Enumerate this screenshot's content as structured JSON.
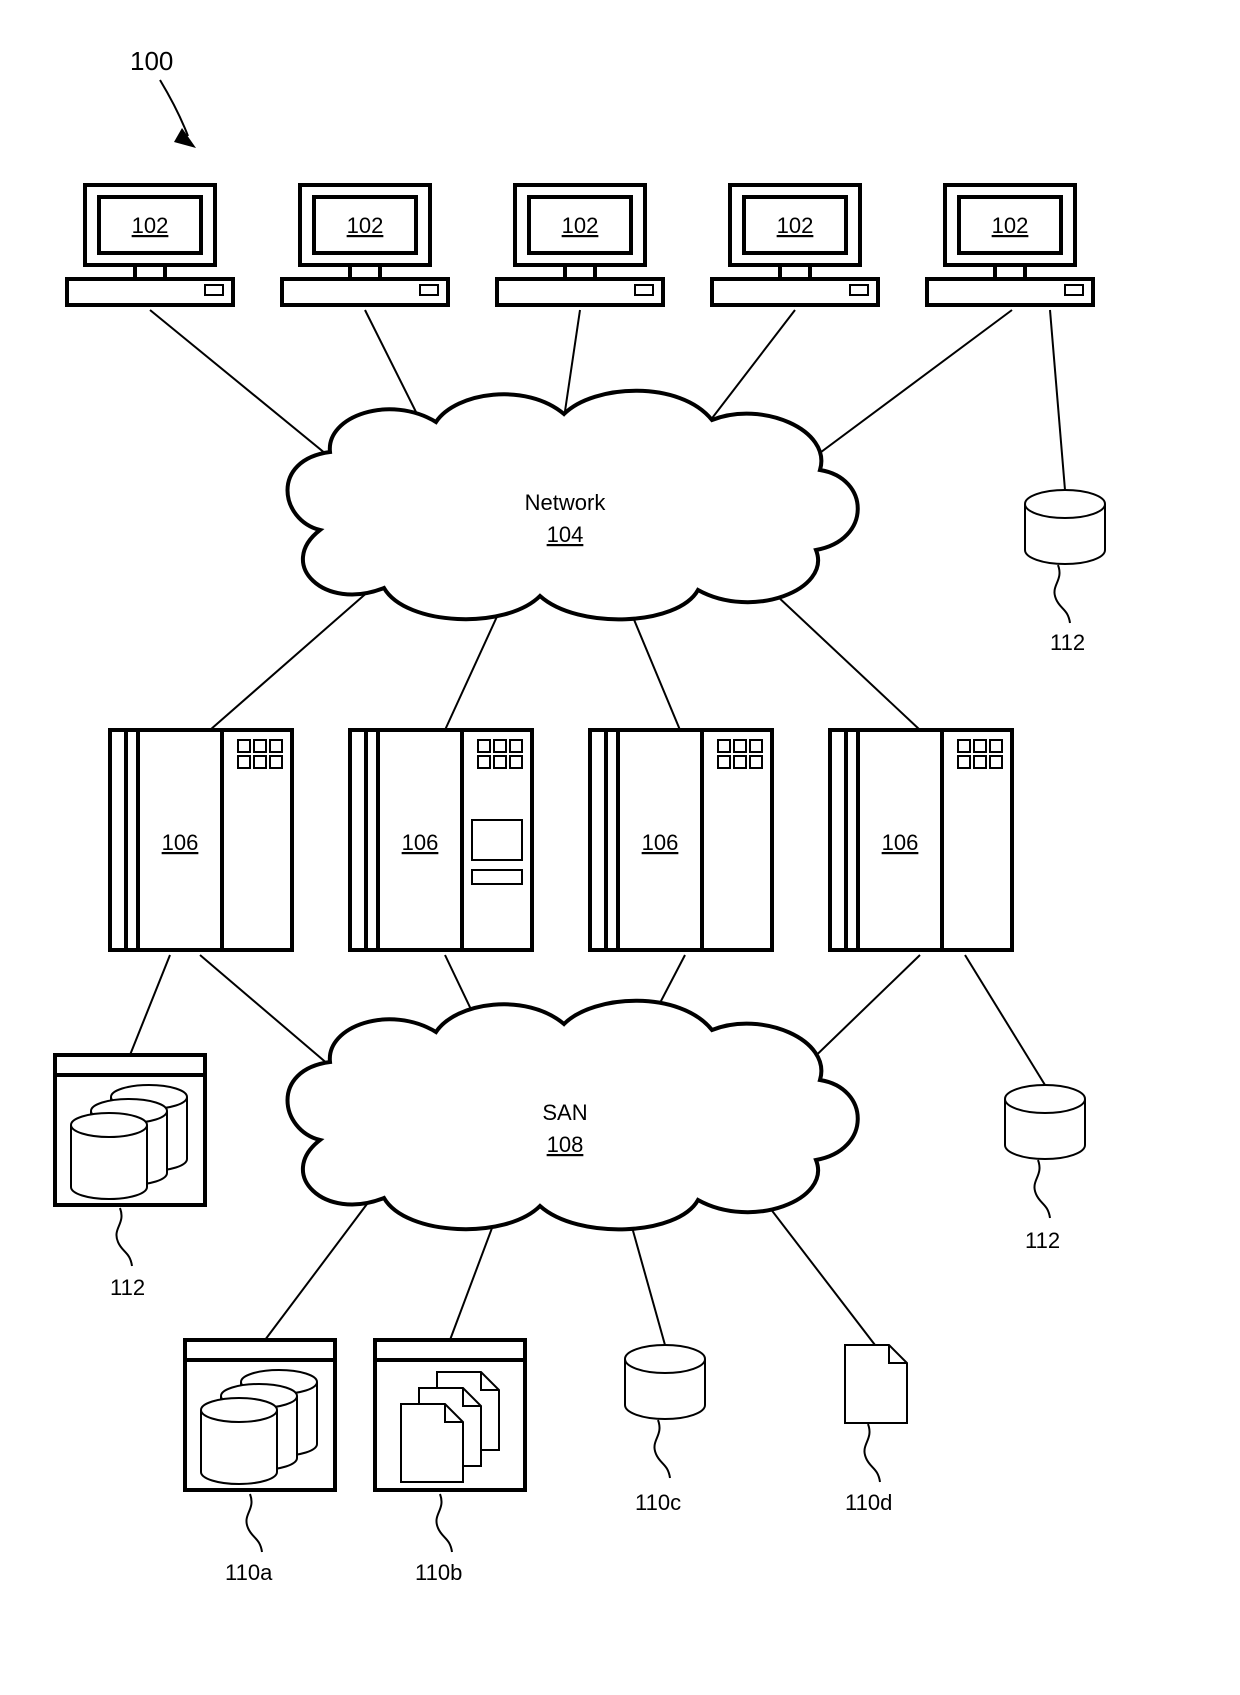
{
  "figure_ref": "100",
  "clients": {
    "label": "102",
    "count": 5
  },
  "network_cloud": {
    "title": "Network",
    "ref": "104"
  },
  "servers": {
    "label": "106",
    "count": 4
  },
  "san_cloud": {
    "title": "SAN",
    "ref": "108"
  },
  "das_labels": {
    "top_right": "112",
    "left": "112",
    "right": "112"
  },
  "storage": {
    "a": "110a",
    "b": "110b",
    "c": "110c",
    "d": "110d"
  }
}
